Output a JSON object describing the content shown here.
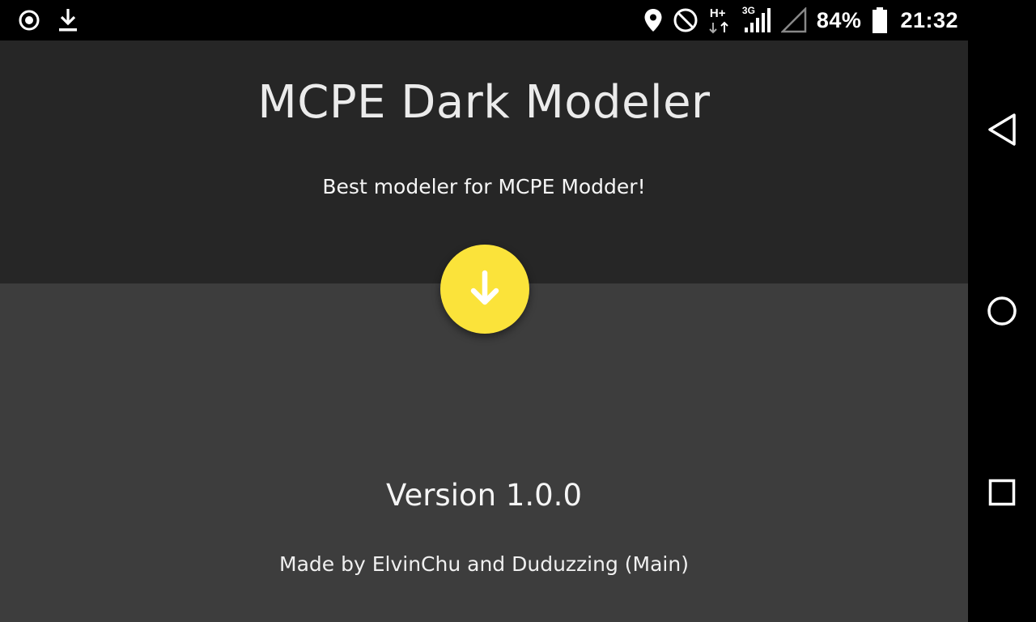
{
  "status_bar": {
    "left_icons": [
      "record-indicator-icon",
      "download-icon"
    ],
    "right_icons": [
      "location-icon",
      "do-not-disturb-icon",
      "h-plus-network-icon",
      "3g-signal-icon",
      "signal-strength-icon",
      "battery-icon"
    ],
    "network_type": "H+",
    "secondary_network": "3G",
    "battery_percent": "84%",
    "time": "21:32"
  },
  "app": {
    "title": "MCPE Dark Modeler",
    "subtitle": "Best modeler for MCPE Modder!",
    "download_fab_icon": "arrow-down-icon",
    "version": "Version 1.0.0",
    "credits": "Made by ElvinChu and Duduzzing (Main)",
    "cutoff_text": ""
  },
  "nav_bar": {
    "buttons": [
      "back-icon",
      "home-icon",
      "recents-icon"
    ]
  },
  "colors": {
    "header_bg": "#262626",
    "body_bg": "#3d3d3d",
    "fab": "#fbe33a",
    "system_bars": "#000000"
  }
}
